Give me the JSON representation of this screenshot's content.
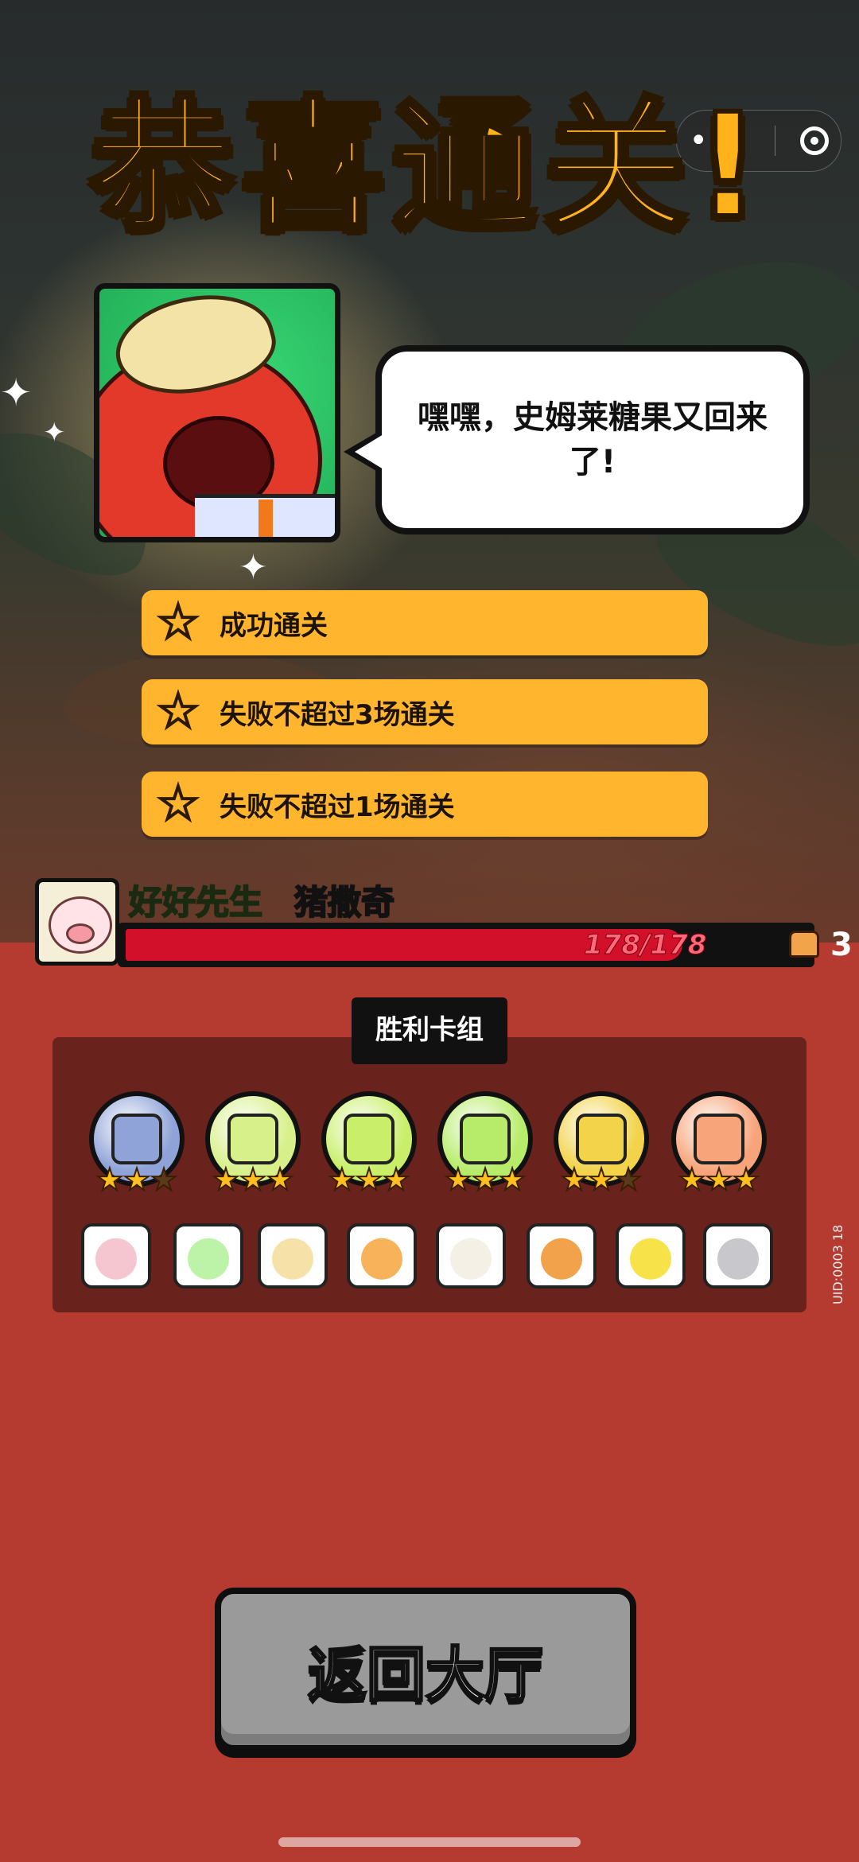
{
  "header": {
    "title": "恭喜通关!"
  },
  "capsule": {
    "dots": "•••"
  },
  "dialogue": {
    "text": "嘿嘿，史姆莱糖果又回来了!"
  },
  "objectives": [
    {
      "label": "成功通关",
      "achieved": true
    },
    {
      "label": "失败不超过3场通关",
      "achieved": true
    },
    {
      "label": "失败不超过1场通关",
      "achieved": true
    }
  ],
  "player": {
    "title": "好好先生",
    "name": "猪撒奇",
    "hp_current": "178",
    "hp_separator": "/",
    "hp_max": "178",
    "wins": "3"
  },
  "deck": {
    "label": "胜利卡组",
    "cards": [
      {
        "icon": "cowboy-hat-chest-card-icon",
        "stars": 2,
        "max_stars": 3,
        "color": "#8fa3d8"
      },
      {
        "icon": "bubble-orbs-card-icon",
        "stars": 3,
        "max_stars": 3,
        "color": "#d8f08a"
      },
      {
        "icon": "colored-balls-card-icon",
        "stars": 3,
        "max_stars": 3,
        "color": "#c9ef6a"
      },
      {
        "icon": "potion-bottle-card-icon",
        "stars": 3,
        "max_stars": 3,
        "color": "#b7ec6a"
      },
      {
        "icon": "herb-plate-card-icon",
        "stars": 2,
        "max_stars": 3,
        "color": "#f2d34a"
      },
      {
        "icon": "dessert-cup-card-icon",
        "stars": 3,
        "max_stars": 3,
        "color": "#f7a47a"
      }
    ],
    "items": [
      {
        "icon": "milk-carton-icon",
        "color": "#f6c6d0"
      },
      {
        "icon": "green-drink-icon",
        "color": "#bdf3a8"
      },
      {
        "icon": "paper-sheets-icon",
        "color": "#f6e2a8"
      },
      {
        "icon": "bottle-and-fruit-icon",
        "color": "#f7b25a"
      },
      {
        "icon": "garlic-friend-icon",
        "color": "#f4f0e6"
      },
      {
        "icon": "jelly-pudding-icon",
        "color": "#f2a24a"
      },
      {
        "icon": "yellow-slime-icon",
        "color": "#f8e24a"
      },
      {
        "icon": "gray-mouse-icon",
        "color": "#c8c8cc"
      }
    ]
  },
  "actions": {
    "back_label": "返回大厅"
  },
  "footer": {
    "uid": "UID:0003 18"
  }
}
